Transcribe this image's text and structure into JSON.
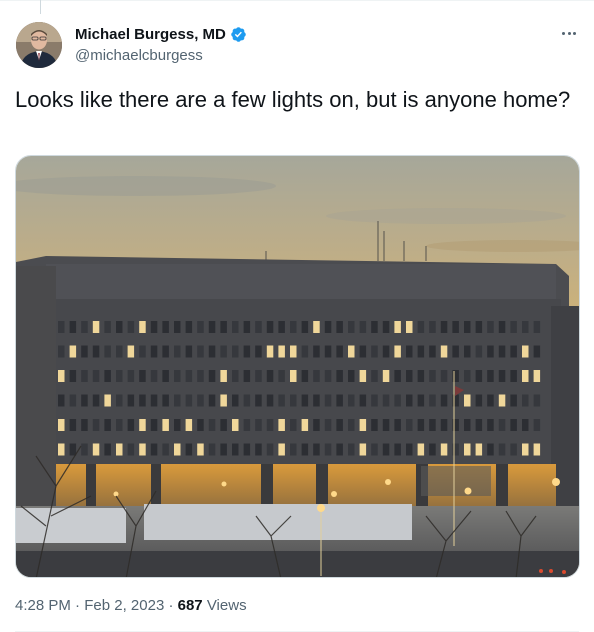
{
  "author": {
    "display_name": "Michael Burgess, MD",
    "handle": "@michaelcburgess",
    "verified": true
  },
  "tweet": {
    "text": "Looks like there are a few lights on, but is anyone home?"
  },
  "meta": {
    "time": "4:28 PM",
    "separator": "·",
    "date": "Feb 2, 2023",
    "views_count": "687",
    "views_label": "Views"
  },
  "icons": {
    "verified": "verified-badge-icon",
    "more": "more-options-icon"
  },
  "colors": {
    "verified_blue": "#1d9bf0",
    "secondary_text": "#536471",
    "primary_text": "#0f1419"
  }
}
